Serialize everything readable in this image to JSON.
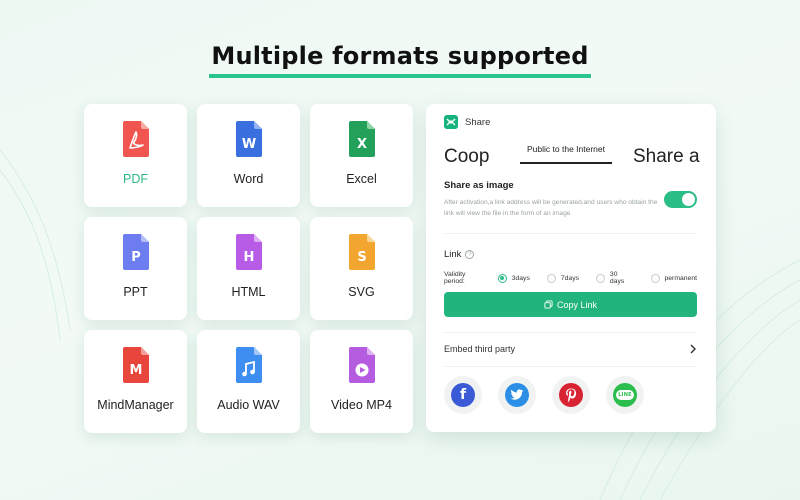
{
  "headline": "Multiple formats supported",
  "formats": [
    {
      "label": "PDF",
      "letter": "",
      "color": "#f0564f",
      "light": "#f9a8a3",
      "active": true
    },
    {
      "label": "Word",
      "letter": "W",
      "color": "#3a6fe0",
      "light": "#93b2f5",
      "active": false
    },
    {
      "label": "Excel",
      "letter": "X",
      "color": "#23a05a",
      "light": "#8fd6a9",
      "active": false
    },
    {
      "label": "PPT",
      "letter": "P",
      "color": "#6d7df0",
      "light": "#b4bdf8",
      "active": false
    },
    {
      "label": "HTML",
      "letter": "H",
      "color": "#b85ce8",
      "light": "#dcb0f4",
      "active": false
    },
    {
      "label": "SVG",
      "letter": "S",
      "color": "#f2a630",
      "light": "#f9d594",
      "active": false
    },
    {
      "label": "MindManager",
      "letter": "M",
      "color": "#e8453c",
      "light": "#f5a09a",
      "active": false
    },
    {
      "label": "Audio WAV",
      "letter": "",
      "color": "#3d8ef0",
      "light": "#a3c8f8",
      "active": false
    },
    {
      "label": "Video MP4",
      "letter": "",
      "color": "#b65ce0",
      "light": "#ddb2f2",
      "active": false
    }
  ],
  "share_panel": {
    "title": "Share",
    "tabs": {
      "left": "Coop",
      "active": "Public to the Internet",
      "right": "Share a"
    },
    "share_as_image": {
      "title": "Share as image",
      "description": "After activation,a link address will be generated,and users who obtain the link will view the file in the form of an image",
      "enabled": true
    },
    "link": {
      "title": "Link",
      "help": "?",
      "validity_label": "Validity period:",
      "options": [
        "3days",
        "7days",
        "30 days",
        "permanent"
      ],
      "selected": "3days"
    },
    "copy_link_label": "Copy Link",
    "embed_label": "Embed third party",
    "socials": [
      "facebook-icon",
      "twitter-icon",
      "pinterest-icon",
      "line-icon"
    ],
    "line_label": "LINE"
  },
  "colors": {
    "accent": "#22b47d",
    "facebook": "#3b5bd6",
    "twitter": "#2b8fe6",
    "pinterest": "#d82333",
    "line": "#2bbd4e"
  }
}
